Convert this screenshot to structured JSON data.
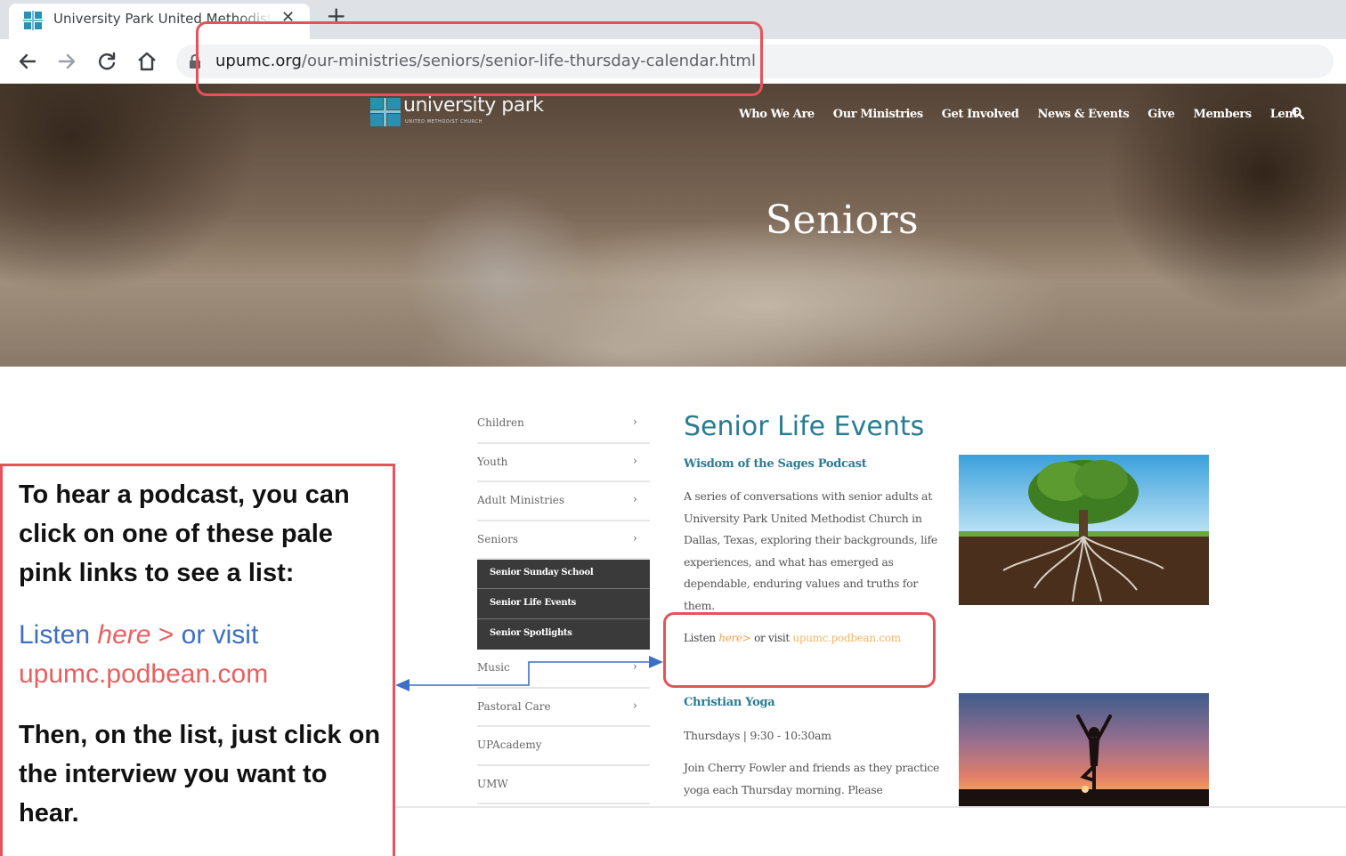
{
  "browser": {
    "tab_title": "University Park United Methodist Church",
    "tab_close": "✕",
    "new_tab": "+",
    "url_domain": "upumc.org",
    "url_path": "/our-ministries/seniors/senior-life-thursday-calendar.html"
  },
  "site": {
    "logo_text": "university park",
    "logo_sub": "UNITED METHODIST CHURCH",
    "nav": [
      "Who We Are",
      "Our Ministries",
      "Get Involved",
      "News & Events",
      "Give",
      "Members",
      "Lent"
    ],
    "hero_title": "Seniors"
  },
  "side_menu": {
    "items_before": [
      {
        "label": "Children",
        "chevron": "›"
      },
      {
        "label": "Youth",
        "chevron": "›"
      },
      {
        "label": "Adult Ministries",
        "chevron": "›"
      },
      {
        "label": "Seniors",
        "chevron": "›"
      }
    ],
    "submenu": [
      "Senior Sunday School",
      "Senior Life Events",
      "Senior Spotlights"
    ],
    "items_after": [
      {
        "label": "Music",
        "chevron": "›"
      },
      {
        "label": "Pastoral Care",
        "chevron": "›"
      },
      {
        "label": "UPAcademy",
        "chevron": ""
      },
      {
        "label": "UMW",
        "chevron": ""
      }
    ]
  },
  "content": {
    "title": "Senior Life Events",
    "podcast_heading": "Wisdom of the Sages Podcast",
    "podcast_desc": "A series of conversations with senior adults at University Park United Methodist Church in Dallas, Texas, exploring their backgrounds, life experiences, and what has emerged as dependable, enduring values and truths for them.",
    "listen_prefix": "Listen ",
    "listen_here": "here>",
    "listen_mid": " or visit ",
    "listen_link": "upumc.podbean.com",
    "yoga_heading": "Christian Yoga",
    "yoga_time": "Thursdays | 9:30 - 10:30am",
    "yoga_desc": "Join Cherry Fowler and friends as they practice yoga each Thursday morning. Please"
  },
  "annotation": {
    "intro": "To hear a podcast, you can click on one of these pale pink links to see a list:",
    "listen_word": "Listen ",
    "here_word": "here",
    "gt": " >",
    "or_visit": " or visit",
    "link": "upumc.podbean.com",
    "outro": "Then, on the list, just click on the interview you want to hear."
  },
  "colors": {
    "highlight_red": "#e7525a",
    "heading_teal": "#2a7c93",
    "link_orange": "#f0a04e",
    "annotation_blue": "#3d6fc4",
    "annotation_pink": "#e86060",
    "submenu_dark": "#3a3a3a"
  }
}
